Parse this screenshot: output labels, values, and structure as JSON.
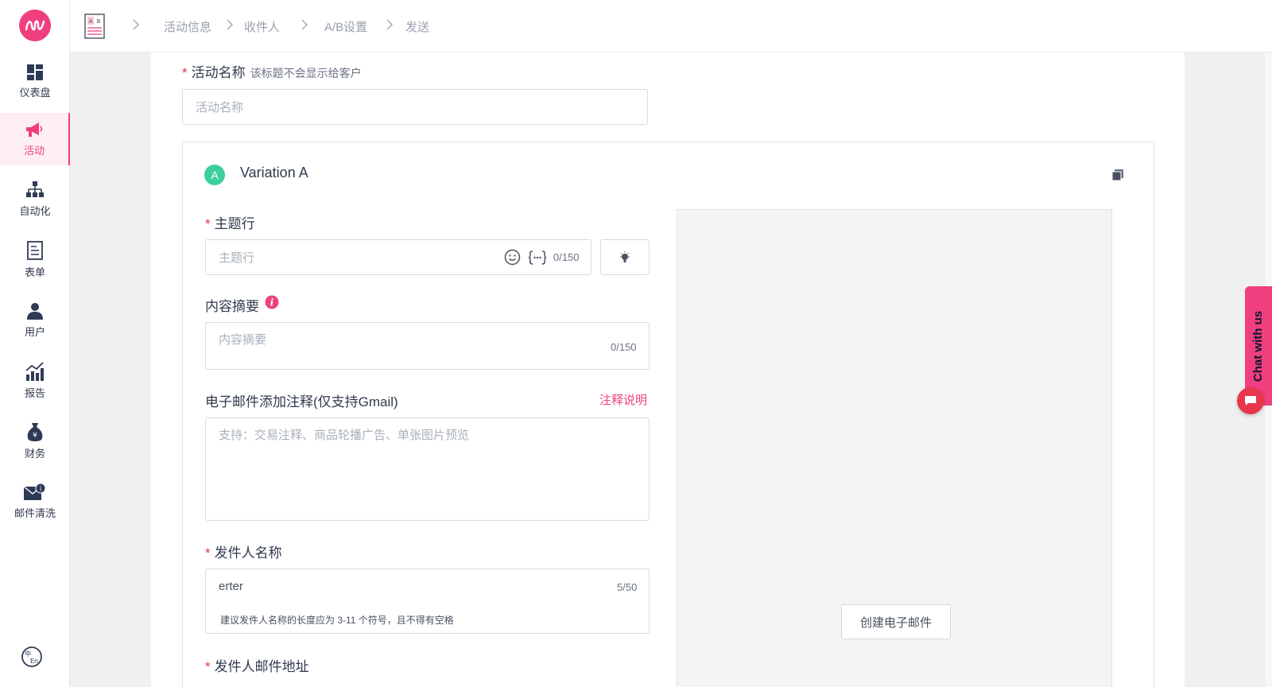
{
  "sidebar": {
    "items": [
      {
        "label": "仪表盘",
        "icon": "dashboard-icon"
      },
      {
        "label": "活动",
        "icon": "megaphone-icon",
        "active": true
      },
      {
        "label": "自动化",
        "icon": "sitemap-icon"
      },
      {
        "label": "表单",
        "icon": "form-icon"
      },
      {
        "label": "用户",
        "icon": "user-icon"
      },
      {
        "label": "报告",
        "icon": "chart-icon"
      },
      {
        "label": "财务",
        "icon": "money-bag-icon"
      },
      {
        "label": "邮件清洗",
        "icon": "mail-clean-icon"
      }
    ]
  },
  "breadcrumb": [
    "活动信息",
    "收件人",
    "A/B设置",
    "发送"
  ],
  "form": {
    "campaign_name_label": "活动名称",
    "campaign_name_hint": "该标题不会显示给客户",
    "campaign_name_placeholder": "活动名称",
    "variation_badge": "A",
    "variation_title": "Variation A",
    "subject_label": "主题行",
    "subject_placeholder": "主题行",
    "subject_counter": "0/150",
    "preheader_label": "内容摘要",
    "preheader_placeholder": "内容摘要",
    "preheader_counter": "0/150",
    "annotation_label": "电子邮件添加注释(仅支持Gmail)",
    "annotation_link": "注释说明",
    "annotation_placeholder": "支持：交易注释、商品轮播广告、单张图片预览",
    "sender_name_label": "发件人名称",
    "sender_name_value": "erter",
    "sender_name_counter": "5/50",
    "sender_name_hint": "建议发件人名称的长度应为 3-11 个符号，且不得有空格",
    "sender_email_label": "发件人邮件地址",
    "create_email_button": "创建电子邮件",
    "required_mark": "*"
  },
  "chat": {
    "label": "Chat with us"
  },
  "colors": {
    "accent": "#ef3f7e",
    "badge": "#3ccf9e",
    "required": "#e8364a"
  }
}
